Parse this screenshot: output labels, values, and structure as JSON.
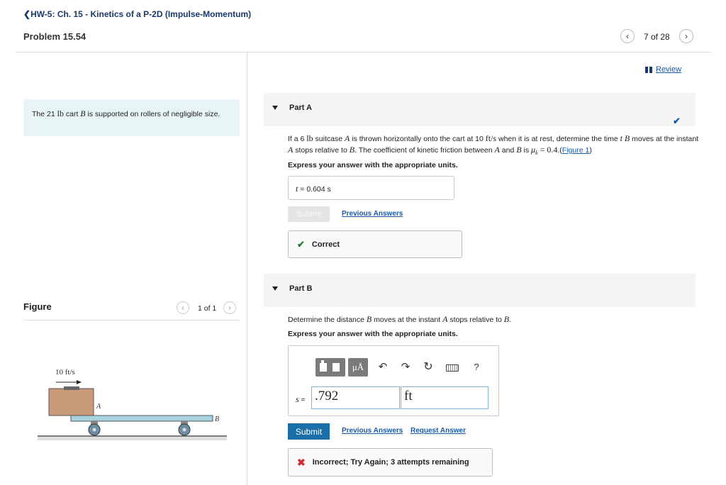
{
  "header": {
    "assignment_title": "HW-5: Ch. 15 - Kinetics of a P-2D (Impulse-Momentum)",
    "problem_title": "Problem 15.54",
    "back_icon": "chevron-left-icon",
    "page_counter": "7 of 28",
    "prev_icon": "chevron-left-icon",
    "next_icon": "chevron-right-icon"
  },
  "review": {
    "label": "Review",
    "icon": "review-icon"
  },
  "intro": {
    "p1": "The 21 ",
    "unit": "lb",
    "p2": " cart ",
    "var": "B",
    "p3": " is supported on rollers of negligible size."
  },
  "figure": {
    "label": "Figure",
    "counter": "1 of 1",
    "speed_label": "10 ft/s",
    "label_A": "A",
    "label_B": "B"
  },
  "partA": {
    "title": "Part A",
    "question": {
      "t1": "If a 6 ",
      "t2": "lb",
      "t3": " suitcase ",
      "t4": "A",
      "t5": " is thrown horizontally onto the cart at 10 ",
      "t6": "ft/s",
      "t7": " when it is at rest, determine the time ",
      "t8": "t",
      "t9": " ",
      "t10": "B",
      "t11": " moves at the instant ",
      "t12": "A",
      "t13": " stops relative to ",
      "t14": "B",
      "t15": ". The coefficient of kinetic friction between ",
      "t16": "A",
      "t17": " and ",
      "t18": "B",
      "t19": " is ",
      "t20": "μ",
      "t21": "k",
      "t22": " = 0.4",
      "t23": ".(",
      "t24": "Figure 1",
      "t25": ")"
    },
    "instruction": "Express your answer with the appropriate units.",
    "answer": {
      "var": "t",
      "eq": " = ",
      "value": "0.604 s"
    },
    "submit_label": "Submit",
    "previous_answers": "Previous Answers",
    "result": "Correct",
    "status_icon": "checkmark-icon",
    "status_color": "#2e7d32"
  },
  "partB": {
    "title": "Part B",
    "question": {
      "t1": "Determine the distance ",
      "t2": "B",
      "t3": " moves at the instant ",
      "t4": "A",
      "t5": " stops relative to ",
      "t6": "B",
      "t7": "."
    },
    "instruction": "Express your answer with the appropriate units.",
    "toolbar": {
      "templates_icon": "templates-icon",
      "units_label": "μÅ",
      "undo_icon": "undo-icon",
      "redo_icon": "redo-icon",
      "reset_icon": "reset-icon",
      "keyboard_icon": "keyboard-icon",
      "help_label": "?"
    },
    "answer": {
      "var": "s",
      "eq": " = ",
      "value": ".792",
      "unit": "ft"
    },
    "submit_label": "Submit",
    "previous_answers": "Previous Answers",
    "request_answer": "Request Answer",
    "result": "Incorrect; Try Again; 3 attempts remaining",
    "result_icon": "x-icon",
    "result_color": "#d32f2f"
  },
  "colors": {
    "accent": "#1a6fa8",
    "link": "#1a5aa6",
    "intro_bg": "#e8f5f6",
    "part_header_bg": "#f4f4f4"
  }
}
